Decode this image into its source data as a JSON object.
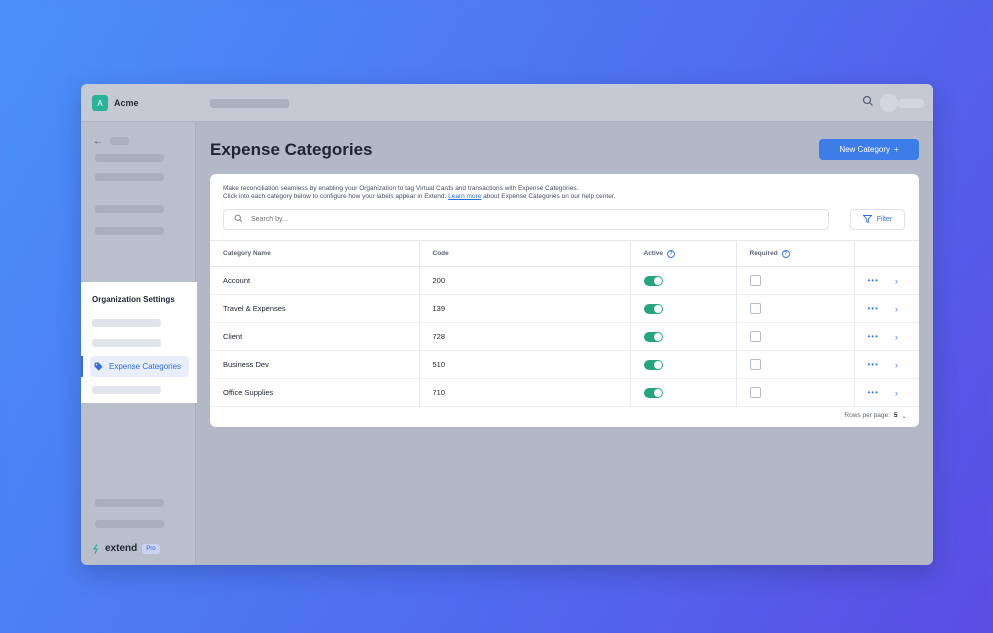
{
  "topbar": {
    "org_initial": "A",
    "org_name": "Acme"
  },
  "sidebar": {
    "section_title": "Organization Settings",
    "active_item": "Expense Categories",
    "brand": "extend",
    "brand_badge": "Pro"
  },
  "main": {
    "title": "Expense Categories",
    "new_button": "New Category",
    "new_button_icon": "+",
    "description_line1": "Make reconciliation seamless by enabling your Organization to tag Virtual Cards and transactions with Expense Categories.",
    "description_line2_pre": "Click into each category below to configure how your labels appear in Extend.",
    "description_link": "Learn more",
    "description_line2_post": "about Expense Categories on our help center.",
    "search_placeholder": "Search by...",
    "filter_label": "Filter",
    "columns": [
      "Category Name",
      "Code",
      "Active",
      "Required"
    ],
    "rows": [
      {
        "name": "Account",
        "code": "200",
        "active": true,
        "required": false
      },
      {
        "name": "Travel & Expenses",
        "code": "139",
        "active": true,
        "required": false
      },
      {
        "name": "Client",
        "code": "728",
        "active": true,
        "required": false
      },
      {
        "name": "Business Dev",
        "code": "510",
        "active": true,
        "required": false
      },
      {
        "name": "Office Supplies",
        "code": "710",
        "active": true,
        "required": false
      }
    ],
    "rows_per_page_label": "Rows per page:",
    "rows_per_page_value": "5"
  },
  "colors": {
    "accent": "#3c7de8",
    "toggle_on": "#24a77f",
    "brand_badge": "#2bb39a"
  }
}
